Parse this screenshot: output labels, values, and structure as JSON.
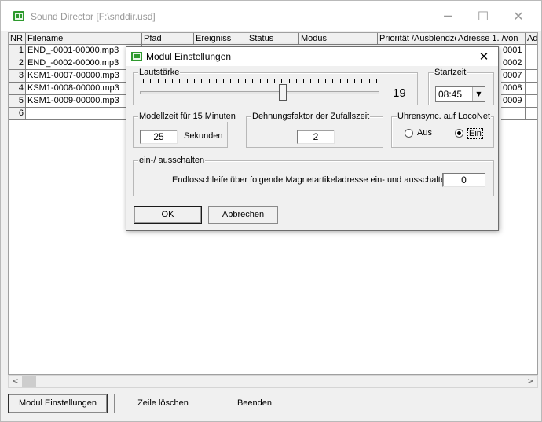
{
  "window": {
    "title": "Sound Director [F:\\snddir.usd]",
    "minimize_glyph": "─",
    "maximize_glyph": "☐",
    "close_glyph": "✕"
  },
  "table": {
    "columns": [
      "NR",
      "Filename",
      "Pfad",
      "Ereigniss",
      "Status",
      "Modus",
      "Priorität /Ausblendzeit",
      "Adresse 1. /von",
      "Ad"
    ],
    "rows": [
      {
        "nr": "1",
        "filename": "END_-0001-00000.mp3",
        "adresse": "0001"
      },
      {
        "nr": "2",
        "filename": "END_-0002-00000.mp3",
        "adresse": "0002"
      },
      {
        "nr": "3",
        "filename": "KSM1-0007-00000.mp3",
        "adresse": "0007"
      },
      {
        "nr": "4",
        "filename": "KSM1-0008-00000.mp3",
        "adresse": "0008"
      },
      {
        "nr": "5",
        "filename": "KSM1-0009-00000.mp3",
        "adresse": "0009"
      },
      {
        "nr": "6",
        "filename": "",
        "adresse": ""
      }
    ]
  },
  "scrollbar": {
    "left_arrow": "<",
    "right_arrow": ">"
  },
  "bottom_buttons": {
    "modul": "Modul Einstellungen",
    "zeile": "Zeile löschen",
    "beenden": "Beenden"
  },
  "dialog": {
    "title": "Modul Einstellungen",
    "close_glyph": "✕",
    "lautstaerke": {
      "label": "Lautstärke",
      "value": "19",
      "level_fraction": 0.6
    },
    "startzeit": {
      "label": "Startzeit",
      "value": "08:45",
      "arrow": "▼"
    },
    "modellzeit": {
      "label": "Modellzeit für 15 Minuten",
      "value": "25",
      "unit": "Sekunden"
    },
    "dehnung": {
      "label": "Dehnungsfaktor der Zufallszeit",
      "value": "2"
    },
    "uhrensync": {
      "label": "Uhrensync. auf LocoNet",
      "option_aus": "Aus",
      "option_ein": "Ein",
      "selected": "Ein"
    },
    "einaus": {
      "label": "ein-/ ausschalten",
      "text": "Endlosschleife über folgende Magnetartikeladresse ein- und ausschalten",
      "value": "0"
    },
    "ok": "OK",
    "abbrechen": "Abbrechen"
  }
}
